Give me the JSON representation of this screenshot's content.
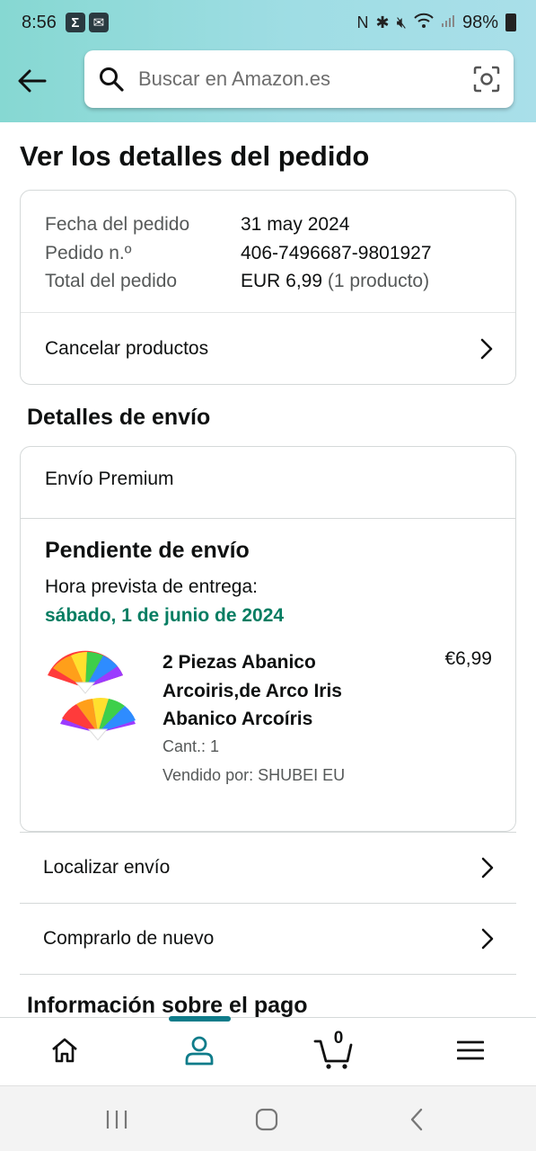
{
  "status_bar": {
    "time": "8:56",
    "battery": "98%"
  },
  "search": {
    "placeholder": "Buscar en Amazon.es"
  },
  "page_title": "Ver los detalles del pedido",
  "order_summary": {
    "rows": [
      {
        "label": "Fecha del pedido",
        "value": "31 may 2024",
        "extra": ""
      },
      {
        "label": "Pedido n.º",
        "value": "406-7496687-9801927",
        "extra": ""
      },
      {
        "label": "Total del pedido",
        "value": "EUR 6,99",
        "extra": " (1 producto)"
      }
    ],
    "cancel_label": "Cancelar productos"
  },
  "shipping": {
    "section_title": "Detalles de envío",
    "shipping_type": "Envío Premium",
    "status": "Pendiente de envío",
    "eta_label": "Hora prevista de entrega:",
    "eta_date": "sábado, 1 de junio de 2024",
    "eta_color": "#067d62",
    "product": {
      "title": "2 Piezas Abanico Arcoiris,de Arco Iris Abanico Arcoíris",
      "price": "€6,99",
      "qty": "Cant.: 1",
      "seller": "Vendido por: SHUBEI EU"
    }
  },
  "actions": {
    "track": "Localizar envío",
    "buy_again": "Comprarlo de nuevo"
  },
  "payment_section_title": "Información sobre el pago",
  "bottom_nav": {
    "items": [
      "home-icon",
      "account-icon",
      "cart-icon",
      "menu-icon"
    ],
    "active_index": 1,
    "cart_count": "0",
    "accent": "#0f7c8a"
  },
  "colors": {
    "header_gradient_start": "#86d8d2",
    "header_gradient_end": "#a9dfe9"
  }
}
